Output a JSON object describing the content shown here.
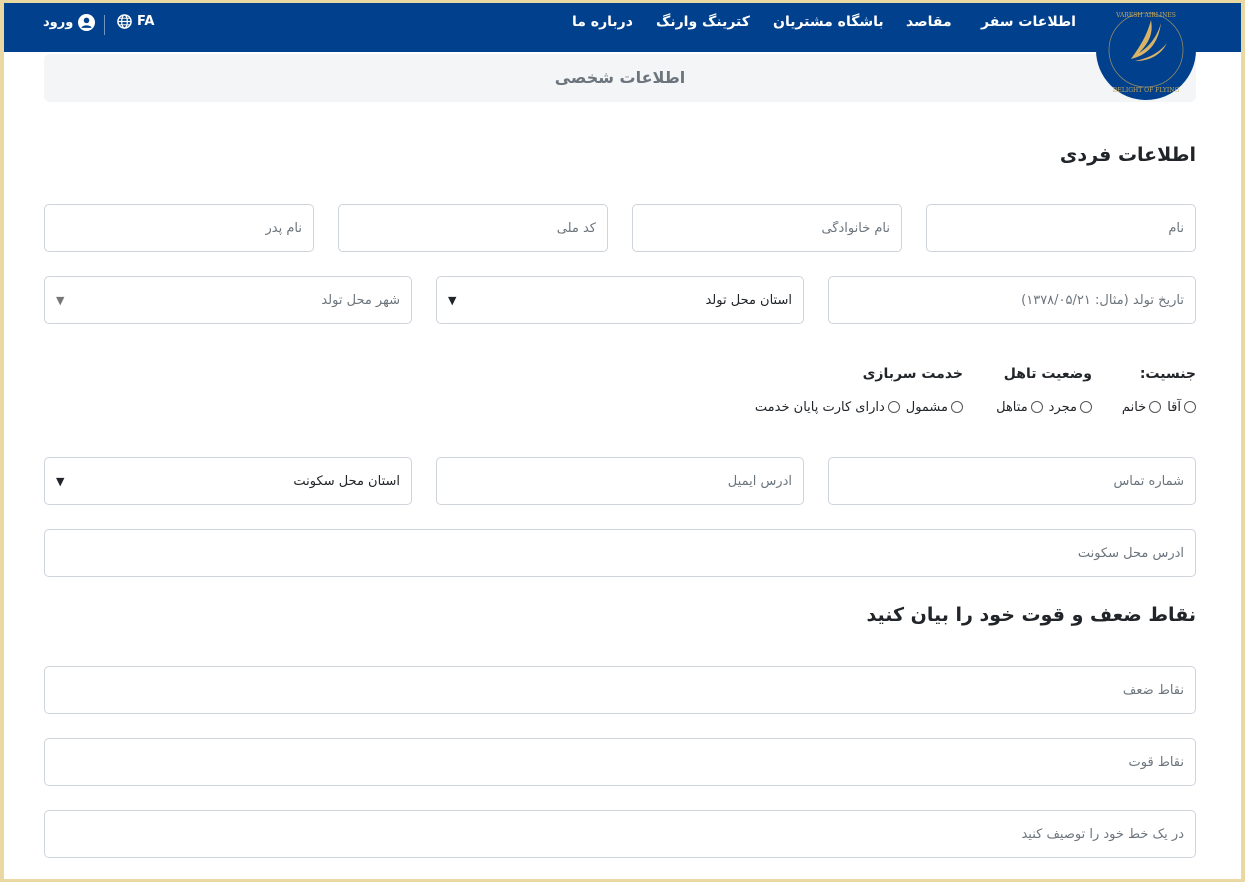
{
  "navbar": {
    "brand_ring_text": "VARESH AIRLINES · DELIGHT OF FLYING",
    "items": [
      {
        "label": "اطلاعات سفر"
      },
      {
        "label": "مقاصد"
      },
      {
        "label": "باشگاه مشتریان"
      },
      {
        "label": "کترینگ وارنگ"
      },
      {
        "label": "درباره ما"
      }
    ],
    "login_label": "ورود",
    "language_label": "FA",
    "color": "#00408c"
  },
  "section_title": "اطلاعات شخصی",
  "personal": {
    "title": "اطلاعات فردی",
    "first_name_placeholder": "نام",
    "last_name_placeholder": "نام خانوادگی",
    "national_code_placeholder": "کد ملی",
    "father_name_placeholder": "نام پدر",
    "birth_date_placeholder": "تاریخ تولد (مثال: ۱۳۷۸/۰۵/۲۱)",
    "birth_province_value": "استان محل تولد",
    "birth_city_value": "شهر محل تولد"
  },
  "gender": {
    "label": "جنسیت:",
    "options": [
      "آقا",
      "خانم"
    ]
  },
  "marital": {
    "label": "وضعیت تاهل",
    "options": [
      "مجرد",
      "متاهل"
    ]
  },
  "military": {
    "label": "خدمت سربازی",
    "options": [
      "مشمول",
      "دارای کارت پایان خدمت"
    ]
  },
  "contact": {
    "phone_placeholder": "شماره تماس",
    "email_placeholder": "آدرس ایمیل",
    "residence_province_value": "استان محل سکونت",
    "address_placeholder": "آدرس محل سکونت"
  },
  "strengths": {
    "title": "نقاط ضعف و قوت خود را بیان کنید",
    "weaknesses_placeholder": "نقاط ضعف",
    "strengths_placeholder": "نقاط قوت",
    "one_line_placeholder": "در یک خط خود را توصیف کنید"
  }
}
